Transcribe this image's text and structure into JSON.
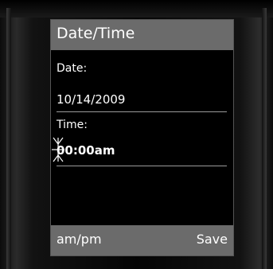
{
  "screen": {
    "title": "Date/Time",
    "date": {
      "label": "Date:",
      "value": "10/14/2009"
    },
    "time": {
      "label": "Time:",
      "value": "00:00am"
    }
  },
  "softkeys": {
    "left_label": "am/pm",
    "right_label": "Save"
  },
  "colors": {
    "title_bar": "#6b6b6b",
    "screen_bg": "#000000",
    "text": "#ffffff",
    "divider": "#9a9a9a"
  }
}
